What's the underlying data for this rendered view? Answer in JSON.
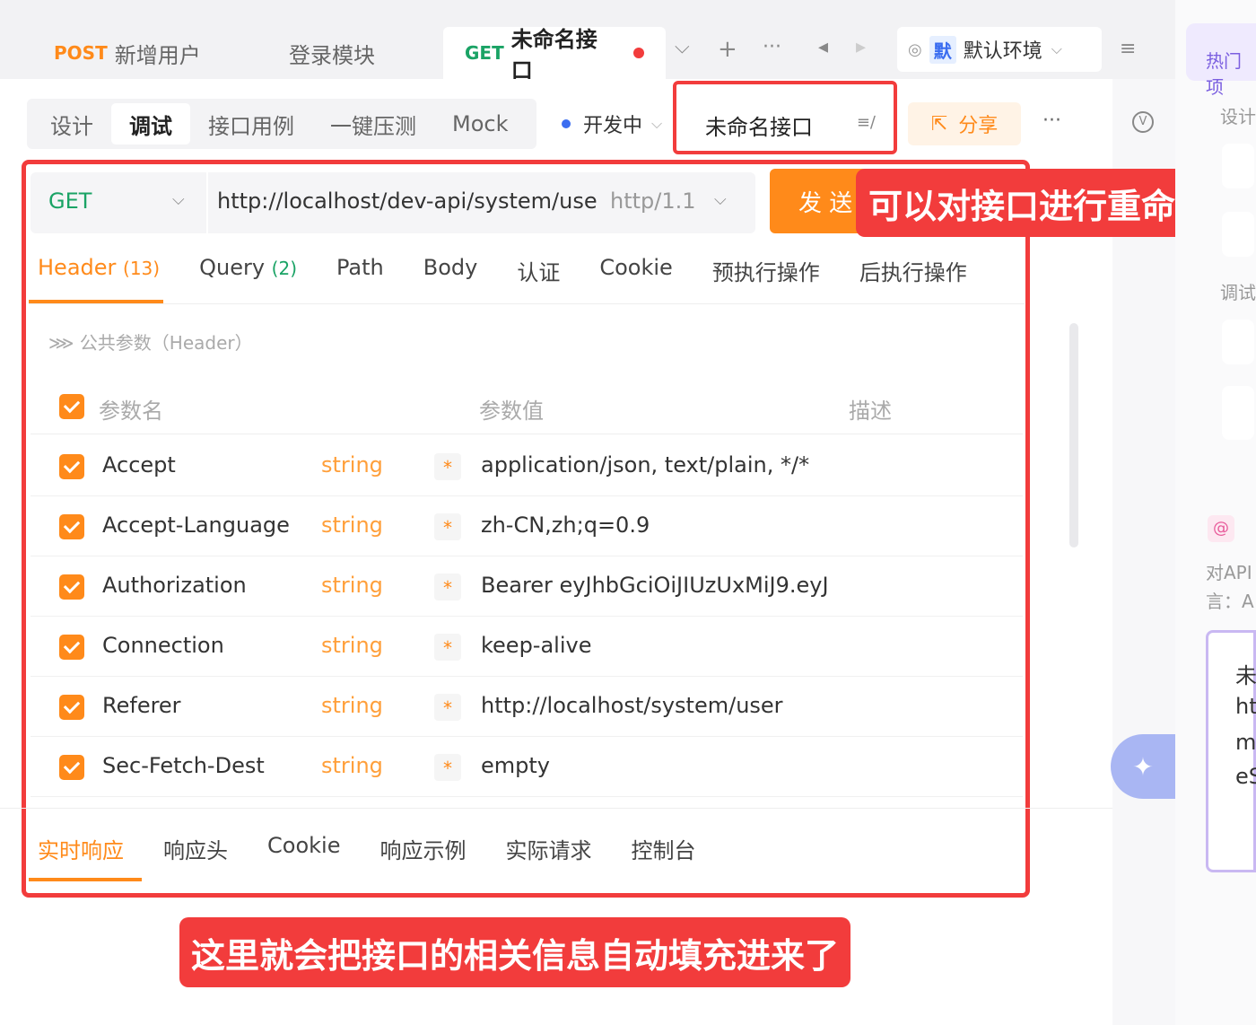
{
  "tabs": [
    {
      "method": "POST",
      "title": "新增用户"
    },
    {
      "method": "",
      "title": "登录模块"
    },
    {
      "method": "GET",
      "title": "未命名接口"
    }
  ],
  "tab_controls": {
    "dropdown": "⌵",
    "add": "+",
    "more": "···",
    "prev": "◂",
    "next": "▸"
  },
  "env": {
    "badge": "默",
    "label": "默认环境",
    "menu": "≡"
  },
  "modes": [
    "设计",
    "调试",
    "接口用例",
    "一键压测",
    "Mock"
  ],
  "status": {
    "label": "开发中"
  },
  "name_field": {
    "value": "未命名接口"
  },
  "share_label": "分享",
  "more_label": "···",
  "request": {
    "method": "GET",
    "url": "http://localhost/dev-api/system/use",
    "protocol": "http/1.1",
    "send_label": "发 送"
  },
  "annotation_top": "可以对接口进行重命名",
  "annotation_bottom": "这里就会把接口的相关信息自动填充进来了",
  "req_tabs": [
    {
      "label": "Header",
      "count": "(13)"
    },
    {
      "label": "Query",
      "count": "(2)"
    },
    {
      "label": "Path"
    },
    {
      "label": "Body"
    },
    {
      "label": "认证"
    },
    {
      "label": "Cookie"
    },
    {
      "label": "预执行操作"
    },
    {
      "label": "后执行操作"
    }
  ],
  "common_params": "公共参数（Header）",
  "columns": {
    "name": "参数名",
    "value": "参数值",
    "desc": "描述"
  },
  "headers": [
    {
      "name": "Accept",
      "type": "string",
      "value": "application/json, text/plain, */*"
    },
    {
      "name": "Accept-Language",
      "type": "string",
      "value": "zh-CN,zh;q=0.9"
    },
    {
      "name": "Authorization",
      "type": "string",
      "value": "Bearer eyJhbGciOiJIUzUxMiJ9.eyJ"
    },
    {
      "name": "Connection",
      "type": "string",
      "value": "keep-alive"
    },
    {
      "name": "Referer",
      "type": "string",
      "value": "http://localhost/system/user"
    },
    {
      "name": "Sec-Fetch-Dest",
      "type": "string",
      "value": "empty"
    }
  ],
  "res_tabs": [
    "实时响应",
    "响应头",
    "Cookie",
    "响应示例",
    "实际请求",
    "控制台"
  ],
  "right_panel": {
    "title": "热门项",
    "design": "设计",
    "debug": "调试",
    "api_text": "对API",
    "lang_text": "言：A",
    "box_lines": [
      "未",
      "ht",
      "m",
      "eS"
    ]
  },
  "colors": {
    "accent": "#ff8a1a",
    "annotation": "#f23c3c",
    "get": "#1aa365"
  }
}
